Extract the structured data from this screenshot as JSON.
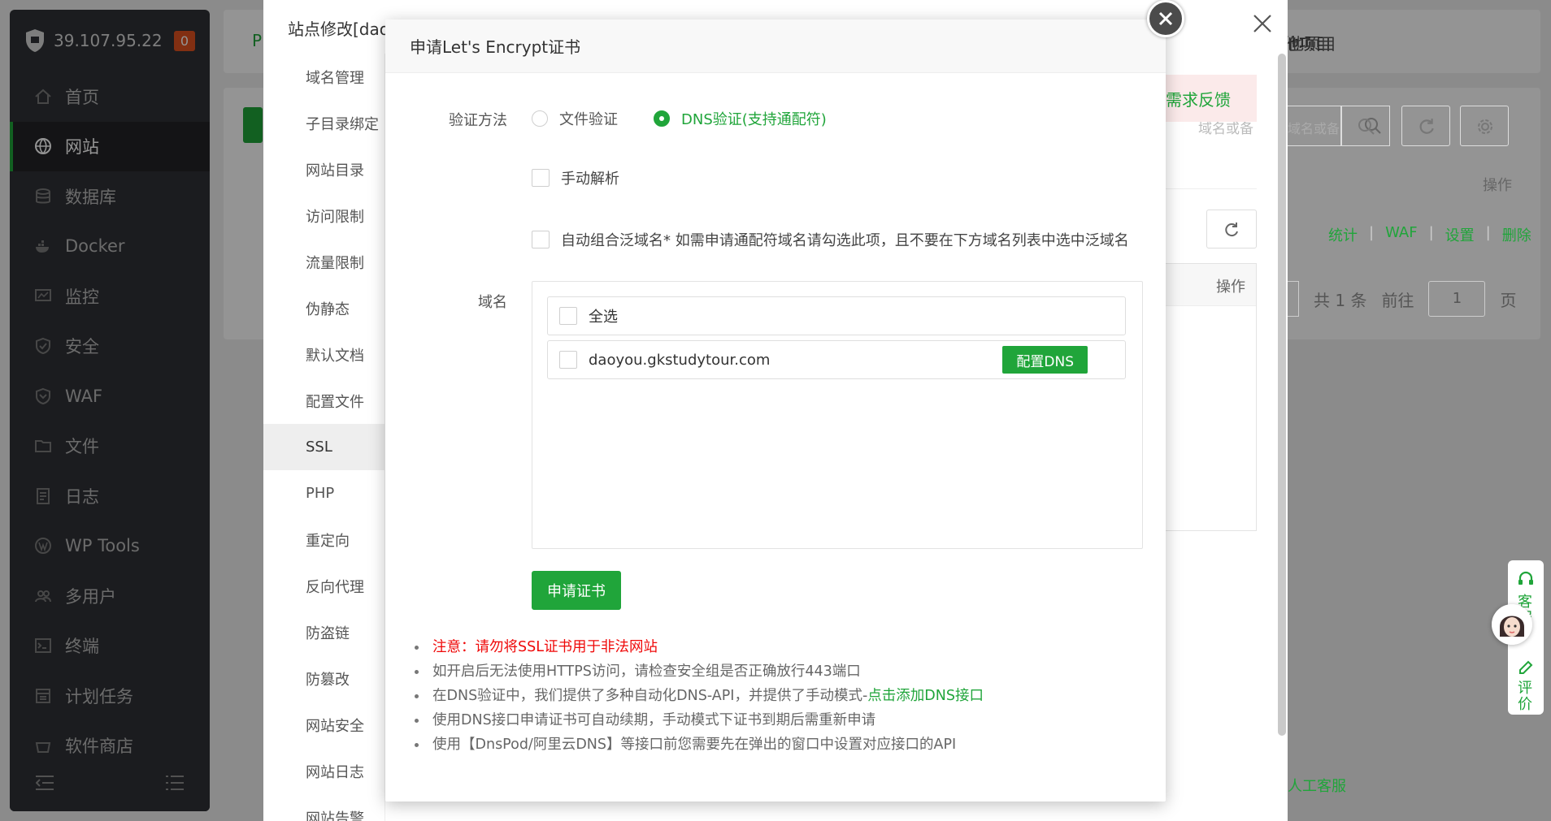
{
  "sidebar": {
    "server_ip": "39.107.95.22",
    "alert_count": "0",
    "items": [
      {
        "label": "首页",
        "icon": "home-icon"
      },
      {
        "label": "网站",
        "icon": "globe-icon",
        "active": true
      },
      {
        "label": "数据库",
        "icon": "database-icon"
      },
      {
        "label": "Docker",
        "icon": "docker-icon"
      },
      {
        "label": "监控",
        "icon": "monitor-icon"
      },
      {
        "label": "安全",
        "icon": "security-shield-icon"
      },
      {
        "label": "WAF",
        "icon": "waf-shield-icon"
      },
      {
        "label": "文件",
        "icon": "folder-icon"
      },
      {
        "label": "日志",
        "icon": "log-icon"
      },
      {
        "label": "WP Tools",
        "icon": "wordpress-icon"
      },
      {
        "label": "多用户",
        "icon": "users-icon"
      },
      {
        "label": "终端",
        "icon": "terminal-icon"
      },
      {
        "label": "计划任务",
        "icon": "calendar-icon"
      },
      {
        "label": "软件商店",
        "icon": "store-icon"
      }
    ]
  },
  "background": {
    "topbar_fragment": "P",
    "right_fragment": "他项目",
    "feedback": "需求反馈",
    "search_placeholder": "域名或备",
    "ops_header": "操作",
    "row_actions": [
      "统计",
      "WAF",
      "设置",
      "删除"
    ],
    "pagination_total": "共 1 条",
    "pagination_goto": "前往",
    "pagination_page": "1",
    "pagination_unit": "页",
    "service_label": "客服",
    "rate_label": "评价",
    "human_service": "人工客服"
  },
  "site_panel": {
    "title": "站点修改[dao",
    "menu": [
      "域名管理",
      "子目录绑定",
      "网站目录",
      "访问限制",
      "流量限制",
      "伪静态",
      "默认文档",
      "配置文件",
      "SSL",
      "PHP",
      "重定向",
      "反向代理",
      "防盗链",
      "防篡改",
      "网站安全",
      "网站日志",
      "网站告警"
    ],
    "active_menu": "SSL"
  },
  "dialog": {
    "title": "申请Let's Encrypt证书",
    "verify_label": "验证方法",
    "verify_options": [
      {
        "label": "文件验证",
        "checked": false
      },
      {
        "label": "DNS验证(支持通配符)",
        "checked": true
      }
    ],
    "manual_resolve": "手动解析",
    "auto_wildcard": "自动组合泛域名* 如需申请通配符域名请勾选此项，且不要在下方域名列表中选中泛域名",
    "domain_label": "域名",
    "select_all": "全选",
    "domains": [
      {
        "name": "daoyou.gkstudytour.com",
        "action": "配置DNS"
      }
    ],
    "apply_button": "申请证书",
    "notes": [
      {
        "text": "注意：请勿将SSL证书用于非法网站",
        "warn": true
      },
      {
        "text": "如开启后无法使用HTTPS访问，请检查安全组是否正确放行443端口"
      },
      {
        "text": "在DNS验证中，我们提供了多种自动化DNS-API，并提供了手动模式-",
        "link": "点击添加DNS接口"
      },
      {
        "text": "使用DNS接口申请证书可自动续期，手动模式下证书到期后需重新申请"
      },
      {
        "text": "使用【DnsPod/阿里云DNS】等接口前您需要先在弹出的窗口中设置对应接口的API"
      }
    ]
  },
  "colors": {
    "accent": "#20a53a",
    "warning": "#ef0808",
    "sidebar_bg": "#2f3136"
  }
}
